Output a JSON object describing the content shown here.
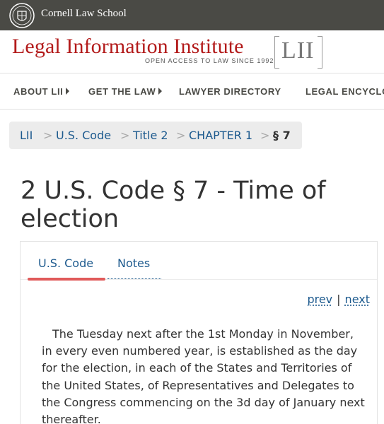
{
  "cornell": {
    "name": "Cornell Law School",
    "seal_icon": "cornell-seal-icon"
  },
  "lii": {
    "title": "Legal Information Institute",
    "tagline": "OPEN ACCESS TO LAW SINCE 1992",
    "logo_text": "LII",
    "brand_color": "#b31b1b"
  },
  "nav": {
    "items": [
      {
        "label": "ABOUT LII",
        "has_caret": true
      },
      {
        "label": "GET THE LAW",
        "has_caret": true
      },
      {
        "label": "LAWYER DIRECTORY",
        "has_caret": false
      },
      {
        "label": "LEGAL ENCYCLOPEDIA",
        "has_caret": false
      }
    ]
  },
  "breadcrumb": {
    "items": [
      "LII",
      "U.S. Code",
      "Title 2",
      "CHAPTER 1"
    ],
    "separator": ">",
    "current": "§ 7"
  },
  "page": {
    "title": "2 U.S. Code § 7 - Time of election"
  },
  "tabs": {
    "items": [
      "U.S. Code",
      "Notes"
    ],
    "active": "U.S. Code",
    "active_color": "#e05a5a"
  },
  "pager": {
    "prev": "prev",
    "separator": "|",
    "next": "next"
  },
  "statute": {
    "text": "The Tuesday next after the 1st Monday in November, in every even numbered year, is established as the day for the election, in each of the States and Territories of the United States, of Representatives and Delegates to the Congress commencing on the 3d day of January next thereafter."
  },
  "colors": {
    "link": "#1d5a8e",
    "header_bar": "#4a4a45"
  }
}
